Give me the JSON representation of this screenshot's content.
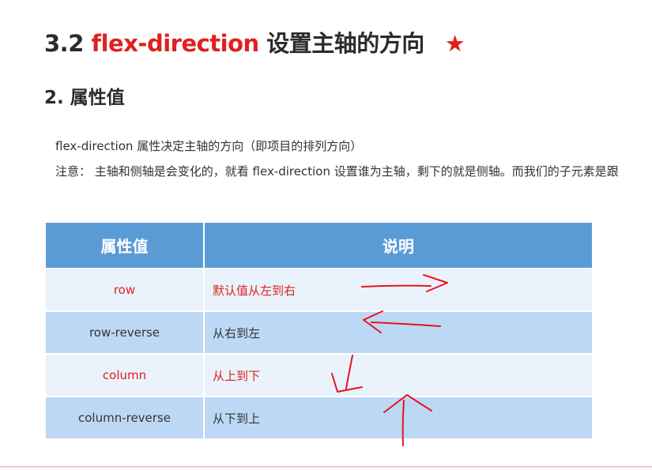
{
  "title": {
    "prefix": "3.2 ",
    "highlight": "flex-direction",
    "suffix": " 设置主轴的方向",
    "star": "★"
  },
  "subtitle": "2. 属性值",
  "paragraphs": [
    "flex-direction 属性决定主轴的方向（即项目的排列方向）",
    "注意： 主轴和侧轴是会变化的，就看 flex-direction 设置谁为主轴，剩下的就是侧轴。而我们的子元素是跟"
  ],
  "table": {
    "headers": [
      "属性值",
      "说明"
    ],
    "rows": [
      {
        "value": "row",
        "desc": "默认值从左到右",
        "red": true
      },
      {
        "value": "row-reverse",
        "desc": "从右到左",
        "red": false
      },
      {
        "value": "column",
        "desc": "从上到下",
        "red": true
      },
      {
        "value": "column-reverse",
        "desc": "从下到上",
        "red": false
      }
    ]
  },
  "colors": {
    "accent_red": "#e02020",
    "header_blue": "#5b9bd5",
    "row_light": "#eaf3fc",
    "row_dark": "#bcd8f4"
  }
}
